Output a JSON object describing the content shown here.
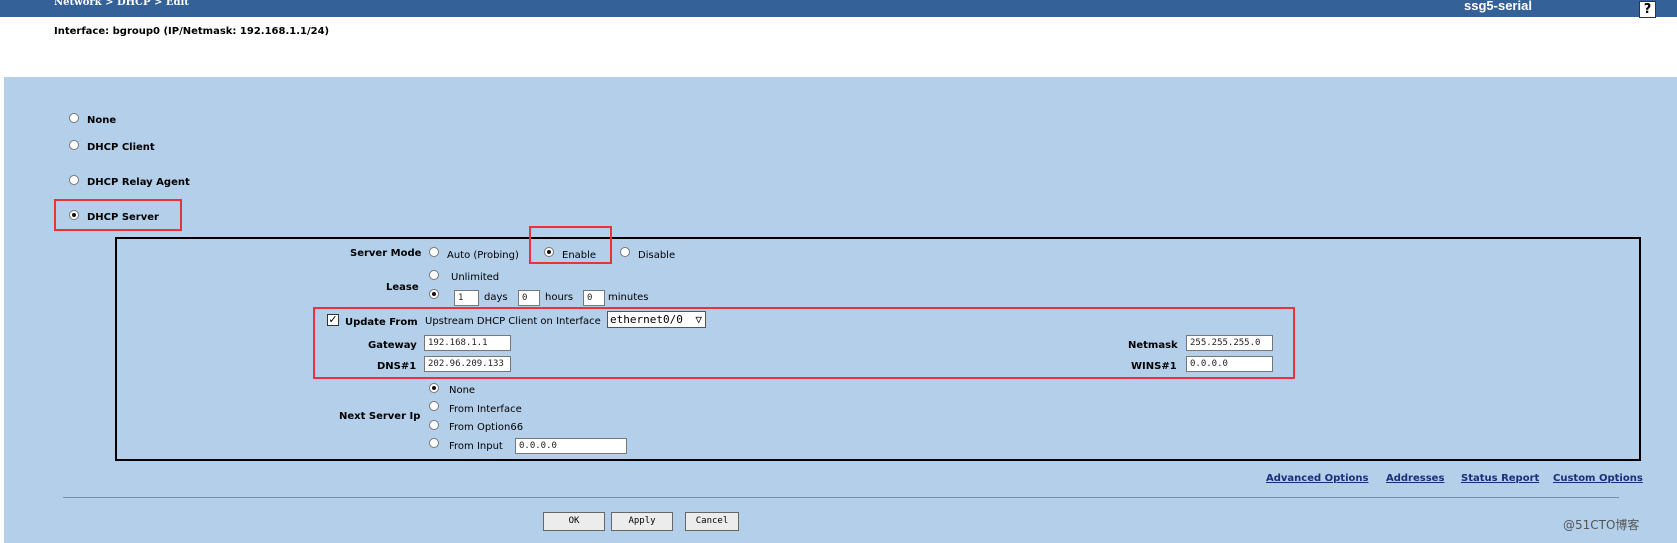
{
  "header": {
    "breadcrumb": "Network > DHCP > Edit",
    "device_name": "ssg5-serial",
    "help_label": "?"
  },
  "interface_info": "Interface: bgroup0 (IP/Netmask: 192.168.1.1/24)",
  "mode_options": [
    {
      "label": "None",
      "selected": false
    },
    {
      "label": "DHCP Client",
      "selected": false
    },
    {
      "label": "DHCP Relay Agent",
      "selected": false
    },
    {
      "label": "DHCP Server",
      "selected": true
    }
  ],
  "server": {
    "server_mode": {
      "label": "Server Mode",
      "options": [
        {
          "label": "Auto (Probing)",
          "selected": false
        },
        {
          "label": "Enable",
          "selected": true
        },
        {
          "label": "Disable",
          "selected": false
        }
      ]
    },
    "lease": {
      "label": "Lease",
      "unlimited_label": "Unlimited",
      "days_value": "1",
      "days_label": "days",
      "hours_value": "0",
      "hours_label": "hours",
      "minutes_value": "0",
      "minutes_label": "minutes"
    },
    "update_from": {
      "checked": true,
      "label": "Update From",
      "source_text": "Upstream DHCP Client on Interface",
      "interface_value": "ethernet0/0",
      "gateway_label": "Gateway",
      "gateway_value": "192.168.1.1",
      "netmask_label": "Netmask",
      "netmask_value": "255.255.255.0",
      "dns1_label": "DNS#1",
      "dns1_value": "202.96.209.133",
      "wins1_label": "WINS#1",
      "wins1_value": "0.0.0.0"
    },
    "next_server_ip": {
      "label": "Next Server Ip",
      "options": [
        {
          "label": "None",
          "selected": true
        },
        {
          "label": "From Interface",
          "selected": false
        },
        {
          "label": "From Option66",
          "selected": false
        },
        {
          "label": "From Input",
          "selected": false
        }
      ],
      "input_value": "0.0.0.0"
    }
  },
  "links": [
    "Advanced Options",
    "Addresses",
    "Status Report",
    "Custom Options"
  ],
  "buttons": {
    "ok": "OK",
    "apply": "Apply",
    "cancel": "Cancel"
  },
  "watermark": "@51CTO博客",
  "colors": {
    "header_bg": "#356199",
    "panel_bg": "#b4cfea",
    "highlight": "#e8333a"
  }
}
